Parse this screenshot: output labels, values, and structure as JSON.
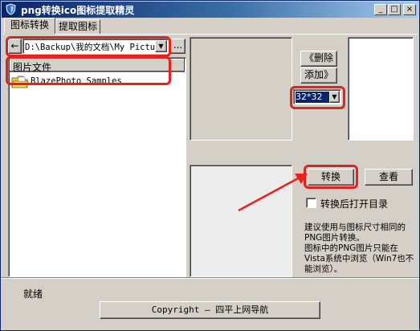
{
  "window": {
    "title": "png转换ico图标提取精灵",
    "minimize": "_",
    "maximize": "□",
    "close": "×"
  },
  "tabs": [
    {
      "label": "图标转换"
    },
    {
      "label": "提取图标"
    }
  ],
  "path_bar": {
    "back_glyph": "←",
    "path": "D:\\Backup\\我的文档\\My Pictu",
    "dropdown_glyph": "▼",
    "browse": "..."
  },
  "file_list": {
    "header": "图片文件",
    "items": [
      {
        "label": "BlazePhoto Samples",
        "icon": "folder-icon"
      }
    ]
  },
  "buttons": {
    "delete": "《删除",
    "add": "添加》",
    "convert": "转换",
    "view": "查看"
  },
  "size_select": {
    "value": "32*32",
    "dropdown_glyph": "▼"
  },
  "open_dir_checkbox": {
    "label": "转换后打开目录",
    "checked": false
  },
  "hint_text": "建议使用与图标尺寸相同的PNG图片转换。\n图标中的PNG图片只能在Vista系统中浏览（Win7也不能浏览）。",
  "status": {
    "text": "就绪"
  },
  "copyright_button": {
    "label": "Copyright — 四平上网导航"
  },
  "colors": {
    "annotation_red": "#e8211d",
    "selection_blue": "#0a246a",
    "face": "#d4d0c8"
  }
}
